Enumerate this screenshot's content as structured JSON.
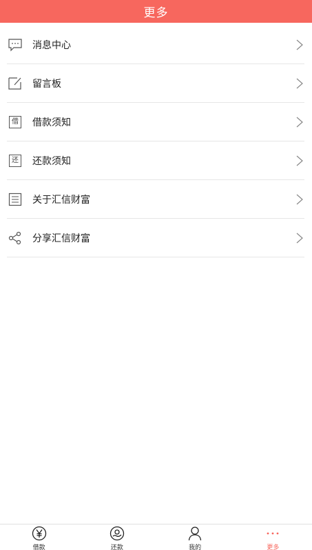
{
  "header": {
    "title": "更多"
  },
  "menu": {
    "items": [
      {
        "label": "消息中心",
        "icon": "message-icon"
      },
      {
        "label": "留言板",
        "icon": "edit-icon"
      },
      {
        "label": "借款须知",
        "icon": "loan-notice-icon",
        "glyph": "借"
      },
      {
        "label": "还款须知",
        "icon": "repay-notice-icon",
        "glyph": "还"
      },
      {
        "label": "关于汇信财富",
        "icon": "document-icon"
      },
      {
        "label": "分享汇信财富",
        "icon": "share-icon"
      }
    ]
  },
  "tabbar": {
    "tabs": [
      {
        "label": "借款",
        "icon": "yen-icon"
      },
      {
        "label": "还款",
        "icon": "repay-icon"
      },
      {
        "label": "我的",
        "icon": "user-icon"
      },
      {
        "label": "更多",
        "icon": "more-dots-icon",
        "active": true
      }
    ]
  },
  "colors": {
    "accent": "#f7675e",
    "divider": "#e6e6e6"
  }
}
